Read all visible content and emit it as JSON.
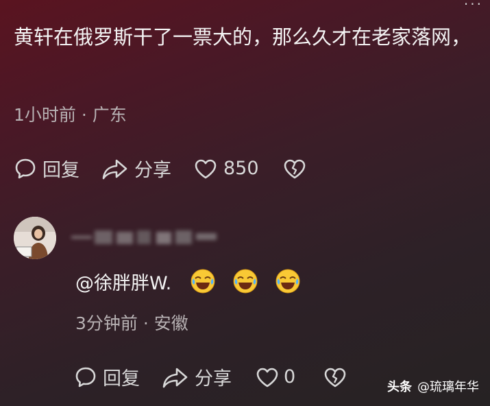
{
  "main_comment": {
    "text": "黄轩在俄罗斯干了一票大的，那么久才在老家落网，",
    "meta": "1小时前 · 广东",
    "actions": {
      "reply": "回复",
      "share": "分享",
      "likes": "850"
    }
  },
  "reply": {
    "text": "@徐胖胖W.",
    "emojis": [
      "crying-laughing-emoji",
      "crying-laughing-emoji",
      "crying-laughing-emoji"
    ],
    "meta": "3分钟前 · 安徽",
    "actions": {
      "reply": "回复",
      "share": "分享",
      "likes": "0"
    }
  },
  "watermark": {
    "brand": "头条",
    "handle": "@琉璃年华"
  },
  "colors": {
    "background_top": "#5a1420",
    "background_bottom": "#262223",
    "icon": "#d8d8d8"
  }
}
